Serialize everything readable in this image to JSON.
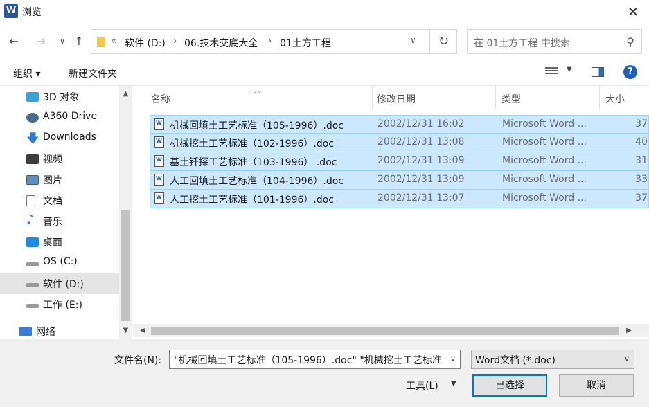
{
  "window": {
    "title": "浏览",
    "app_icon_letter": "W"
  },
  "nav": {
    "back": "←",
    "forward": "→",
    "recent": "∨",
    "up": "↑"
  },
  "address": {
    "segments": [
      "软件 (D:)",
      "06.技术交底大全",
      "01土方工程"
    ],
    "overflow": "«",
    "separator": "›",
    "refresh": "↻"
  },
  "search": {
    "placeholder": "在 01土方工程 中搜索"
  },
  "toolbar": {
    "organize": "组织 ▾",
    "new_folder": "新建文件夹"
  },
  "sidebar": {
    "items": [
      {
        "label": "3D 对象",
        "icon": "cube-icon",
        "color": "#3aa0d8"
      },
      {
        "label": "A360 Drive",
        "icon": "cloud-drive-icon",
        "color": "#4a6b8a"
      },
      {
        "label": "Downloads",
        "icon": "download-icon",
        "color": "#2d7ad6"
      },
      {
        "label": "视频",
        "icon": "video-icon",
        "color": "#3c3c3c"
      },
      {
        "label": "图片",
        "icon": "picture-icon",
        "color": "#5a8fc2"
      },
      {
        "label": "文档",
        "icon": "document-icon",
        "color": "#8a8a8a"
      },
      {
        "label": "音乐",
        "icon": "music-icon",
        "color": "#2d7ad6"
      },
      {
        "label": "桌面",
        "icon": "desktop-icon",
        "color": "#1e88e5"
      },
      {
        "label": "OS (C:)",
        "icon": "drive-icon",
        "color": "#777777"
      },
      {
        "label": "软件 (D:)",
        "icon": "drive-icon",
        "color": "#777777",
        "selected": true
      },
      {
        "label": "工作 (E:)",
        "icon": "drive-icon",
        "color": "#777777"
      }
    ],
    "network": {
      "label": "网络",
      "icon": "network-icon",
      "color": "#3a7bd5"
    }
  },
  "columns": {
    "name": "名称",
    "date": "修改日期",
    "type": "类型",
    "size": "大小"
  },
  "files": [
    {
      "name": "机械回填土工艺标准（105-1996）.doc",
      "date": "2002/12/31 16:02",
      "type": "Microsoft Word ...",
      "size": "37"
    },
    {
      "name": "机械挖土工艺标准（102-1996）.doc",
      "date": "2002/12/31 13:08",
      "type": "Microsoft Word ...",
      "size": "40"
    },
    {
      "name": "基土钎探工艺标准（103-1996） .doc",
      "date": "2002/12/31 13:09",
      "type": "Microsoft Word ...",
      "size": "31"
    },
    {
      "name": "人工回填土工艺标准（104-1996）.doc",
      "date": "2002/12/31 13:09",
      "type": "Microsoft Word ...",
      "size": "33"
    },
    {
      "name": "人工挖土工艺标准（101-1996）.doc",
      "date": "2002/12/31 13:07",
      "type": "Microsoft Word ...",
      "size": "37"
    }
  ],
  "bottom": {
    "filename_label": "文件名(N):",
    "filename_value": "\"机械回填土工艺标准（105-1996）.doc\" \"机械挖土工艺标准",
    "filetype_value": "Word文档 (*.doc)",
    "tools_label": "工具(L)",
    "ok_label": "已选择",
    "cancel_label": "取消"
  },
  "colors": {
    "selection_bg": "#cce8ff",
    "selection_border": "#99d1ff",
    "accent": "#0078d7"
  }
}
